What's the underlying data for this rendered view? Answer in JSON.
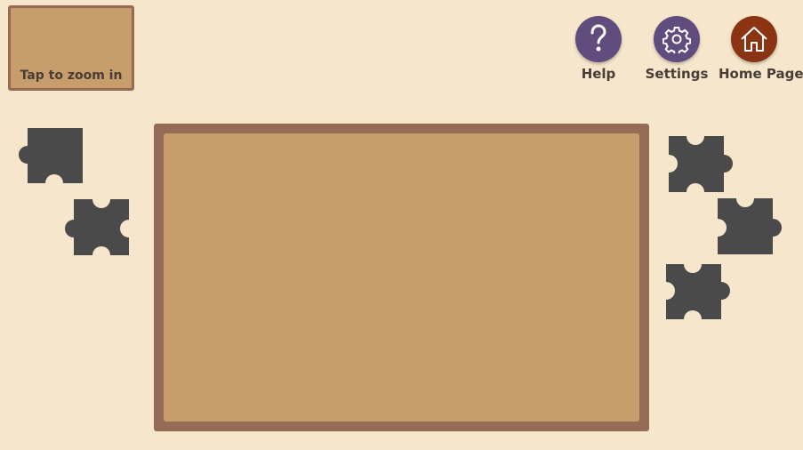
{
  "zoom_preview": {
    "label": "Tap to zoom in"
  },
  "nav": {
    "help": {
      "label": "Help",
      "icon": "question-icon",
      "color": "#614c7e"
    },
    "settings": {
      "label": "Settings",
      "icon": "gear-icon",
      "color": "#614c7e"
    },
    "home": {
      "label": "Home Page",
      "icon": "house-icon",
      "color": "#8b3413"
    }
  },
  "colors": {
    "background": "#f5e6cc",
    "board": "#c79d6c",
    "board_frame": "#956b56",
    "piece": "#4a4a4a"
  },
  "pieces": {
    "left_count": 2,
    "right_count": 3
  }
}
